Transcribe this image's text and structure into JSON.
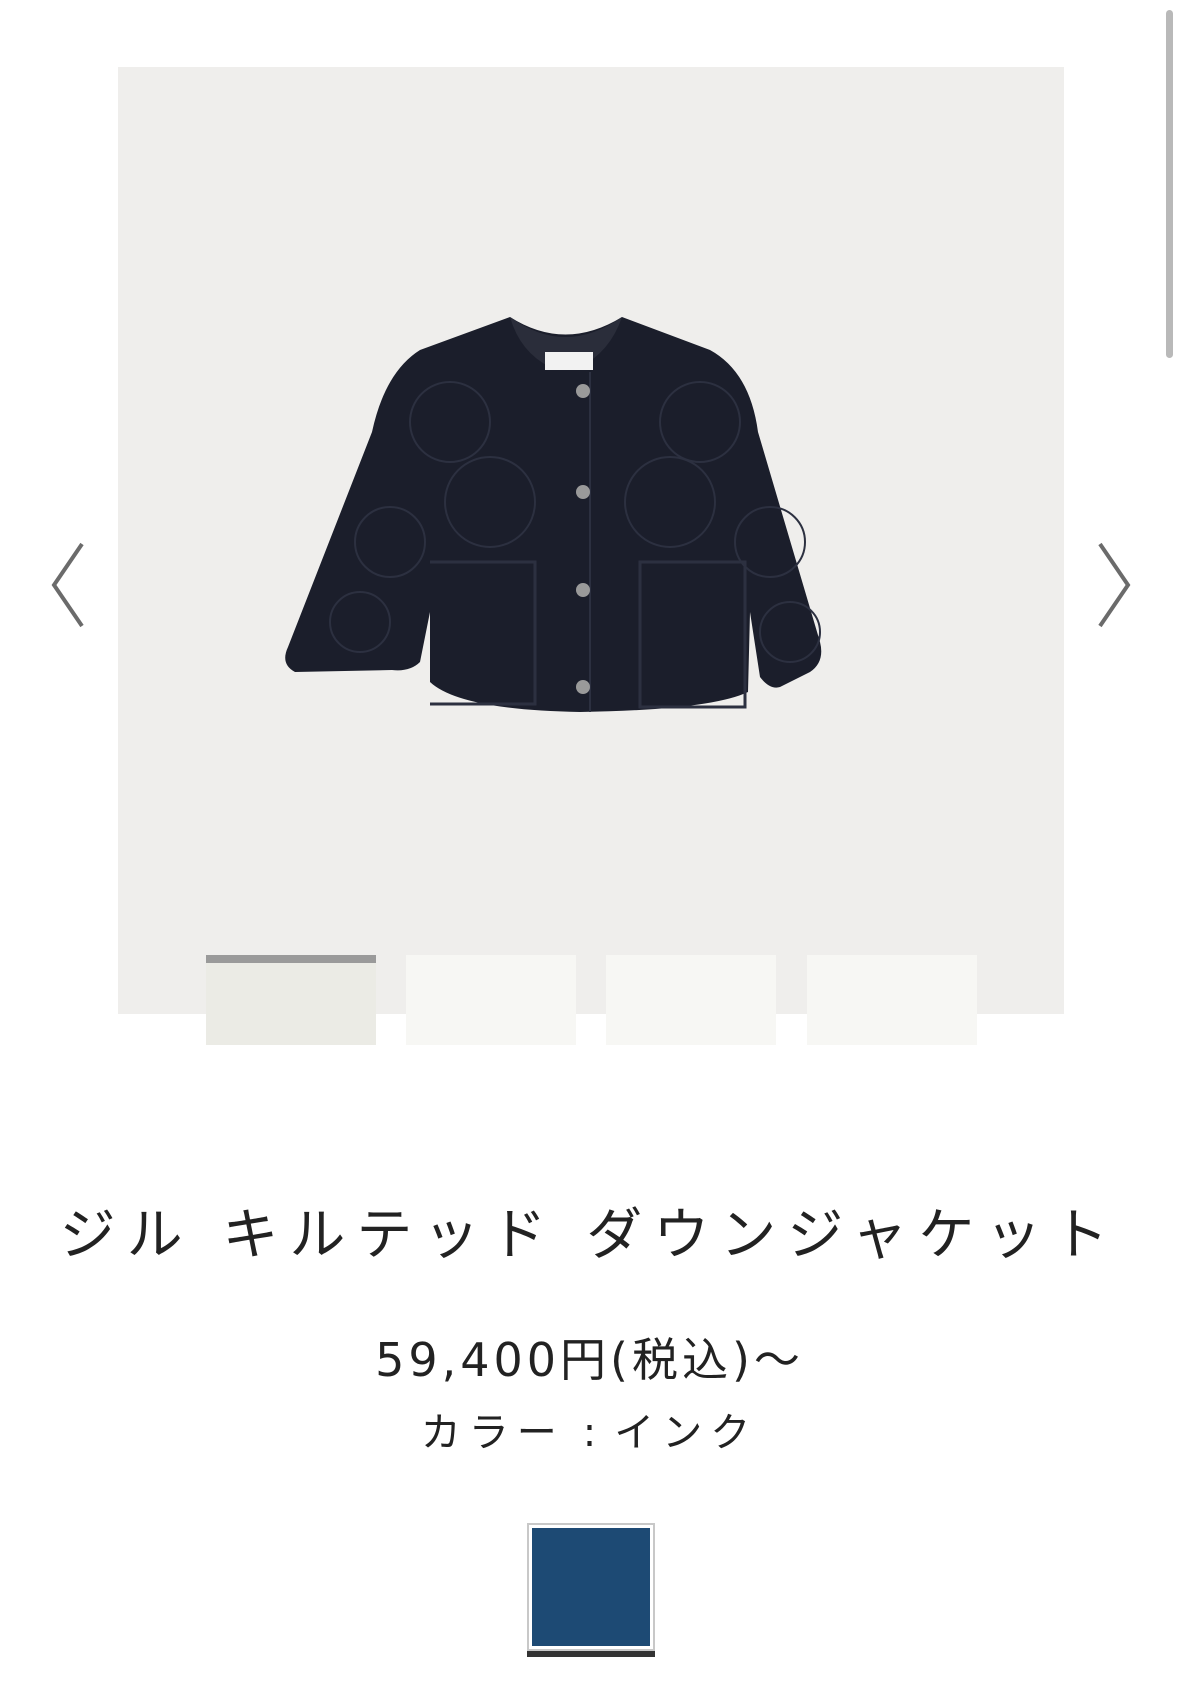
{
  "gallery": {
    "background": "#efeeec",
    "prev_icon": "chevron-left-icon",
    "next_icon": "chevron-right-icon",
    "image_alt": "jacket-product-image",
    "thumbnails": [
      {
        "active": true
      },
      {
        "active": false
      },
      {
        "active": false
      },
      {
        "active": false
      }
    ]
  },
  "product": {
    "title": "ジル キルテッド ダウンジャケット",
    "price": "59,400円(税込)〜",
    "color_label": "カラー",
    "color_separator": ":",
    "color_value": "インク"
  },
  "swatches": [
    {
      "name": "インク",
      "color": "#1d4a74",
      "selected": true
    }
  ],
  "colors": {
    "text": "#222222",
    "jacket": "#1b1e2b",
    "swatch_border": "#c8c8c8",
    "selected_underline": "#333333"
  }
}
